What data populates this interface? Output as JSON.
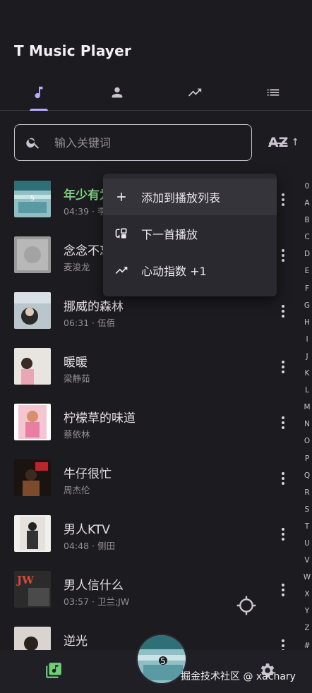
{
  "app": {
    "title": "T Music Player"
  },
  "tabs": [
    {
      "name": "songs",
      "icon": "music-note-icon",
      "selected": true
    },
    {
      "name": "artists",
      "icon": "person-icon",
      "selected": false
    },
    {
      "name": "trending",
      "icon": "trending-up-icon",
      "selected": false
    },
    {
      "name": "playlists",
      "icon": "list-icon",
      "selected": false
    }
  ],
  "search": {
    "placeholder": "输入关键词",
    "value": ""
  },
  "sort": {
    "label": "AZ",
    "direction_icon": "arrow-up-icon"
  },
  "songs": [
    {
      "title": "年少有为",
      "subtitle": "04:39 · 李荣浩",
      "playing": true
    },
    {
      "title": "念念不忘",
      "subtitle": "麦浚龙",
      "playing": false
    },
    {
      "title": "挪威的森林",
      "subtitle": "06:31 · 伍佰",
      "playing": false
    },
    {
      "title": "暖暖",
      "subtitle": "梁静茹",
      "playing": false
    },
    {
      "title": "柠檬草的味道",
      "subtitle": "蔡依林",
      "playing": false
    },
    {
      "title": "牛仔很忙",
      "subtitle": "周杰伦",
      "playing": false
    },
    {
      "title": "男人KTV",
      "subtitle": "04:48 · 侧田",
      "playing": false
    },
    {
      "title": "男人信什么",
      "subtitle": "03:57 · 卫兰;JW",
      "playing": false
    },
    {
      "title": "逆光",
      "subtitle": "",
      "playing": false
    }
  ],
  "alphabet": [
    "0",
    "A",
    "B",
    "C",
    "D",
    "E",
    "F",
    "G",
    "H",
    "I",
    "J",
    "K",
    "L",
    "M",
    "N",
    "O",
    "P",
    "Q",
    "R",
    "S",
    "T",
    "U",
    "V",
    "W",
    "X",
    "Y",
    "Z",
    "#"
  ],
  "context_menu": {
    "items": [
      {
        "label": "添加到播放列表",
        "icon": "plus-icon"
      },
      {
        "label": "下一首播放",
        "icon": "queue-next-icon"
      },
      {
        "label": "心动指数 +1",
        "icon": "trending-up-icon"
      }
    ]
  },
  "bottom_bar": {
    "watermark": "掘金技术社区 @ xachary"
  },
  "colors": {
    "accent": "#b9a9ff",
    "playing": "#7bcf7e",
    "library_icon": "#6fcf73",
    "background": "#1c1b1f"
  }
}
